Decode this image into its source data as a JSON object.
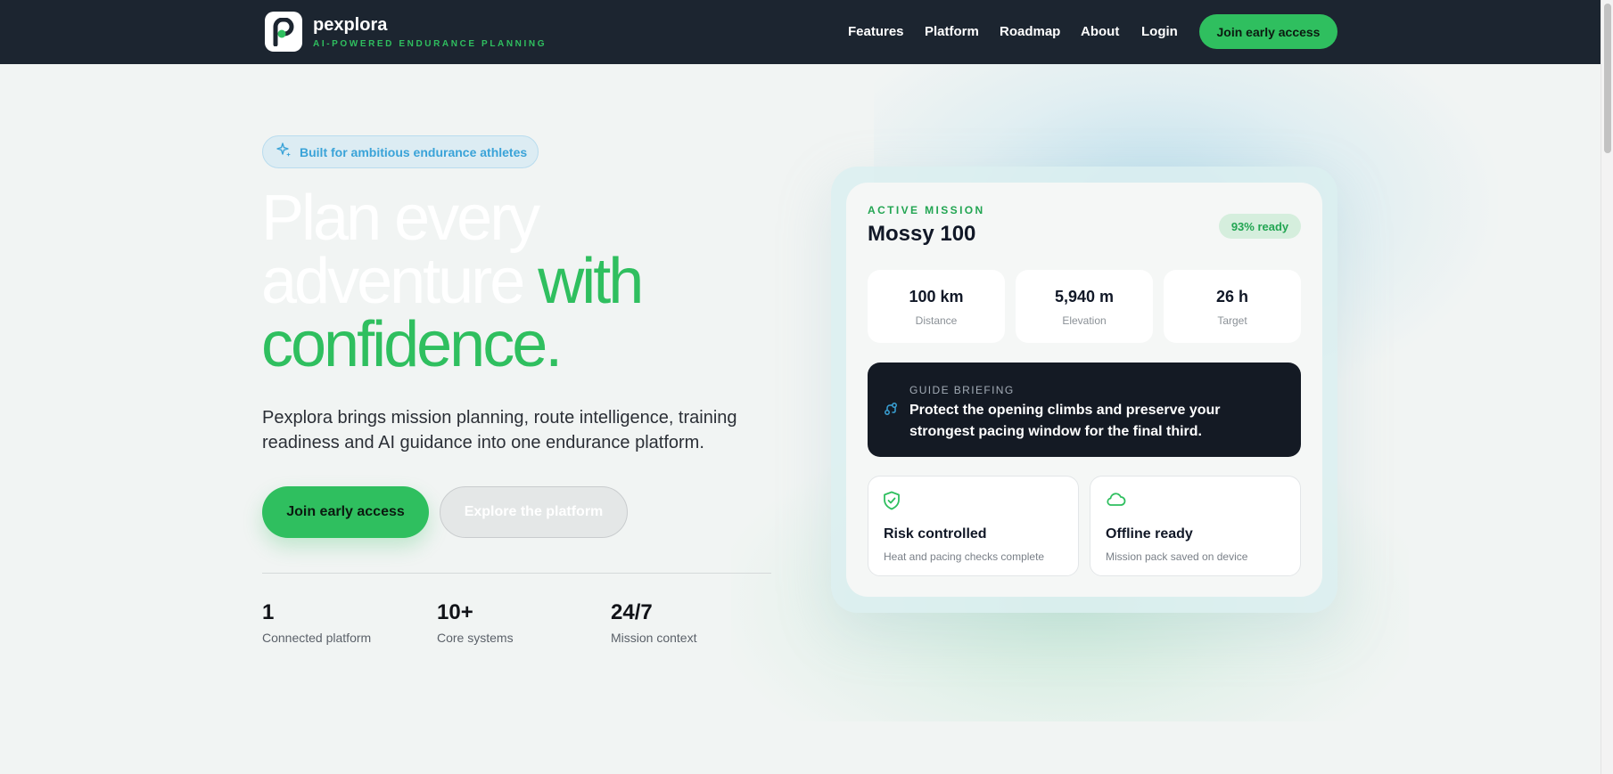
{
  "nav": {
    "brand_name": "pexplora",
    "brand_tagline": "AI-POWERED ENDURANCE PLANNING",
    "links": [
      {
        "label": "Features"
      },
      {
        "label": "Platform"
      },
      {
        "label": "Roadmap"
      },
      {
        "label": "About"
      },
      {
        "label": "Login"
      }
    ],
    "cta_label": "Join early access"
  },
  "hero": {
    "badge_icon": "sparkles-icon",
    "badge_label": "Built for ambitious endurance athletes",
    "headline_line1": "Plan every",
    "headline_line2_white": "adventure ",
    "headline_line2_green": "with",
    "headline_line3": "confidence.",
    "description": "Pexplora brings mission planning, route intelligence, training readiness and AI guidance into one endurance platform.",
    "primary_cta": "Join early access",
    "secondary_cta": "Explore the platform",
    "stats": [
      {
        "value": "1",
        "label": "Connected platform"
      },
      {
        "value": "10+",
        "label": "Core systems"
      },
      {
        "value": "24/7",
        "label": "Mission context"
      }
    ]
  },
  "mission_card": {
    "kicker": "ACTIVE MISSION",
    "title": "Mossy 100",
    "readiness_badge": "93% ready",
    "metrics": [
      {
        "value": "100 km",
        "label": "Distance"
      },
      {
        "value": "5,940 m",
        "label": "Elevation"
      },
      {
        "value": "26 h",
        "label": "Target"
      }
    ],
    "briefing": {
      "icon": "route-icon",
      "kicker": "GUIDE BRIEFING",
      "text": "Protect the opening climbs and preserve your strongest pacing window for the final third."
    },
    "features": [
      {
        "icon": "shield-check-icon",
        "title": "Risk controlled",
        "subtitle": "Heat and pacing checks complete"
      },
      {
        "icon": "cloud-icon",
        "title": "Offline ready",
        "subtitle": "Mission pack saved on device"
      }
    ]
  },
  "colors": {
    "nav_bg": "#1c2530",
    "accent_green": "#2fbf5f",
    "accent_blue": "#3aa3d8",
    "page_bg": "#f1f4f3",
    "briefing_bg": "#141a24"
  }
}
